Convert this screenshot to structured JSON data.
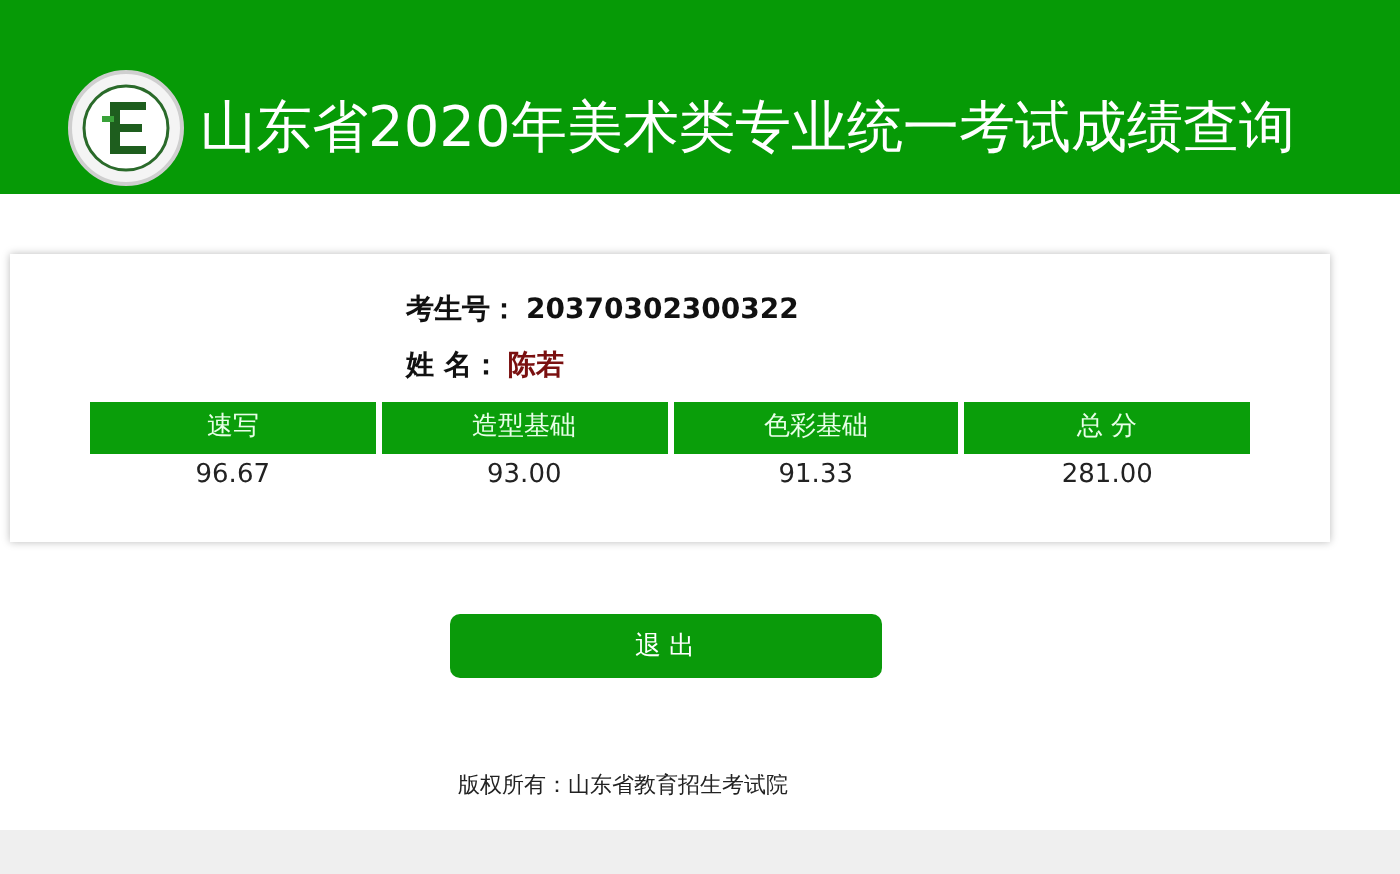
{
  "header": {
    "title": "山东省2020年美术类专业统一考试成绩查询"
  },
  "candidate": [
    {
      "label": "考生号：",
      "value": "20370302300322",
      "kind": "id"
    },
    {
      "label": "姓 名：",
      "value": "陈若",
      "kind": "name"
    }
  ],
  "scores": {
    "columns": [
      "速写",
      "造型基础",
      "色彩基础",
      "总 分"
    ],
    "values": [
      "96.67",
      "93.00",
      "91.33",
      "281.00"
    ]
  },
  "button": {
    "label": "退 出"
  },
  "footer": {
    "text": "版权所有：山东省教育招生考试院"
  }
}
